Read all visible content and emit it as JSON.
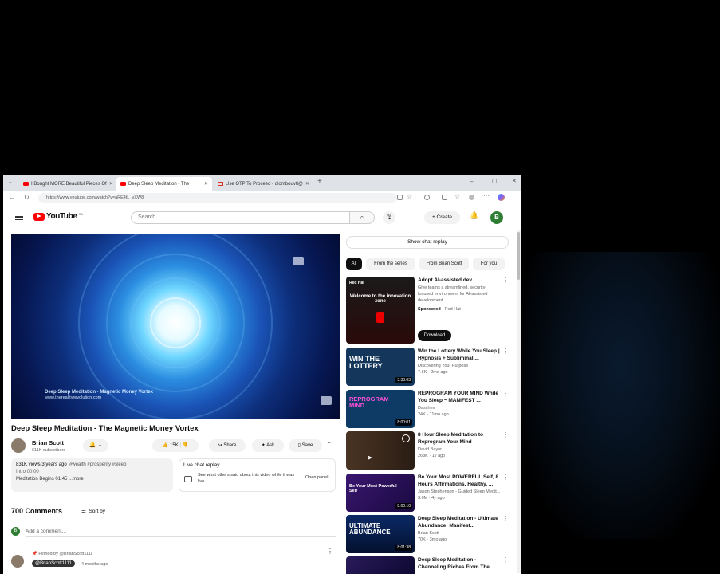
{
  "browser": {
    "tabs": [
      {
        "title": "I Bought MORE Beautiful Pieces Of",
        "active": false,
        "favicon": "youtube-icon"
      },
      {
        "title": "Deep Sleep Meditation - The",
        "active": true,
        "favicon": "youtube-icon"
      },
      {
        "title": "Use OTP To Proceed - dlombouvtl@",
        "active": false,
        "favicon": "gmail-icon"
      }
    ],
    "new_tab": "+",
    "url": "https://www.youtube.com/watch?v=aRE4tL_vXW8"
  },
  "masthead": {
    "logo": "YouTube",
    "logo_suffix": "CA",
    "search_placeholder": "Search",
    "create_label": "+ Create",
    "avatar_letter": "B"
  },
  "player": {
    "overlay_title": "Deep Sleep Meditation - Magnetic Money Vortex",
    "overlay_url": "www.therealityrevolution.com"
  },
  "video": {
    "title": "Deep Sleep Meditation - The Magnetic Money Vortex",
    "channel": "Brian Scott",
    "subscribers": "611K subscribers",
    "like_count": "15K",
    "share_label": "Share",
    "ask_label": "Ask",
    "save_label": "Save",
    "views_date": "831K views  3 years ago",
    "tags": "#wealth #prosperity #sleep",
    "desc_line2": "Intro 00:00",
    "desc_line3": "Meditation Begins 01:45",
    "more": "...more"
  },
  "live_chat": {
    "title": "Live chat replay",
    "description": "See what others said about this video while it was live.",
    "button": "Open panel"
  },
  "comments": {
    "count": "700 Comments",
    "sort": "Sort by",
    "add_placeholder": "Add a comment...",
    "my_avatar": "B",
    "pinned": "Pinned by @BrianScott1111",
    "first_author": "@BrianScott1111",
    "first_time": "4 months ago"
  },
  "sidebar": {
    "chat_replay": "Show chat replay",
    "chips": [
      "All",
      "From the series",
      "From Brian Scott",
      "For you"
    ],
    "ad": {
      "thumb_brand": "Red Hat",
      "thumb_text": "Welcome to the innovation zone",
      "title": "Adopt AI-assisted dev",
      "description": "Give teams a streamlined, security-focused environment for AI-assisted development.",
      "sponsored": "Sponsored",
      "advertiser": "· Red Hat",
      "cta": "Download"
    },
    "videos": [
      {
        "title": "Win the Lottery While You Sleep | Hypnosis + Subliminal ...",
        "channel": "Discovering Your Purpose",
        "meta": "7.6K · 2mo ago",
        "duration": "3:33:03",
        "thumb_text": "WIN THE LOTTERY",
        "thumb_bg": "#14365a"
      },
      {
        "title": "REPROGRAM YOUR MIND While You Sleep ~ MANIFEST ...",
        "channel": "Daschex",
        "meta": "24K · 11mo ago",
        "duration": "8:00:01",
        "thumb_text": "REPROGRAM MIND",
        "thumb_bg": "#0d3b66"
      },
      {
        "title": "8 Hour Sleep Meditation to Reprogram Your Mind",
        "channel": "David Bayer",
        "meta": "268K · 1y ago",
        "duration": "",
        "thumb_text": "",
        "thumb_bg": "#3b2a1e"
      },
      {
        "title": "Be Your Most POWERFUL Self, 8 Hours Affirmations, Healthy, ...",
        "channel": "Jason Stephenson - Guided Sleep Medit...",
        "meta": "3.0M · 4y ago",
        "duration": "8:00:10",
        "thumb_text": "Be Your Most Powerful Self",
        "thumb_bg": "#3a1670"
      },
      {
        "title": "Deep Sleep Meditation - Ultimate Abundance: Manifest...",
        "channel": "Brian Scott",
        "meta": "70K · 3mo ago",
        "duration": "8:01:38",
        "thumb_text": "ULTIMATE ABUNDANCE",
        "thumb_bg": "#081e4a"
      },
      {
        "title": "Deep Sleep Meditation - Channeling Riches From The ...",
        "channel": "",
        "meta": "",
        "duration": "",
        "thumb_text": "",
        "thumb_bg": "#1b1446"
      }
    ]
  }
}
